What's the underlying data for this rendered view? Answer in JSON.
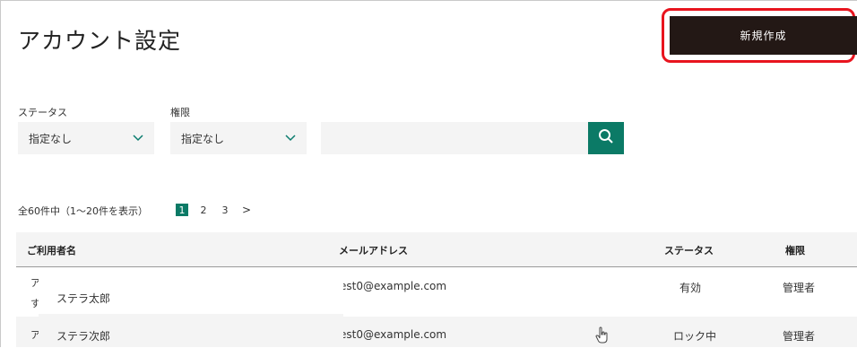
{
  "page": {
    "title": "アカウント設定",
    "new_button": "新規作成"
  },
  "filters": {
    "status_label": "ステータス",
    "status_value": "指定なし",
    "role_label": "権限",
    "role_value": "指定なし",
    "search_value": ""
  },
  "pagination": {
    "summary": "全60件中（1〜20件を表示）",
    "pages": [
      "1",
      "2",
      "3"
    ],
    "current": "1",
    "next": ">"
  },
  "table": {
    "headers": [
      "ご利用者名",
      "メールアドレス",
      "ステータス",
      "権限"
    ],
    "rows": [
      {
        "name_clip_top": "ア",
        "name_clip_bottom": "す",
        "name_popup": "ステラ太郎",
        "email": "est0@example.com",
        "status": "有効",
        "role": "管理者"
      },
      {
        "name_clip_top": "ア",
        "name_popup": "ステラ次郎",
        "email": "est0@example.com",
        "status": "ロック中",
        "role": "管理者"
      }
    ]
  },
  "icons": {
    "search": "search-icon",
    "chevron": "chevron-down-icon",
    "cursor": "hand-pointer-icon"
  },
  "colors": {
    "accent": "#0b7a66",
    "button_dark": "#231815",
    "highlight": "#e8141e"
  }
}
